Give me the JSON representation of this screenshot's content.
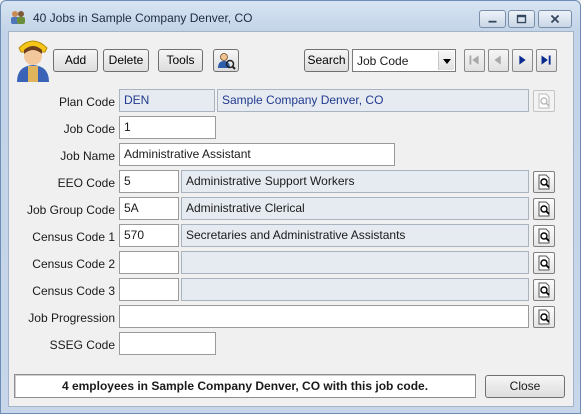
{
  "window": {
    "title": "40 Jobs in Sample Company Denver, CO",
    "controls": {
      "minimize": "minimize-icon",
      "maximize": "maximize-icon",
      "close": "close-icon"
    }
  },
  "toolbar": {
    "add_label": "Add",
    "delete_label": "Delete",
    "tools_label": "Tools",
    "user_icon": "user-search-icon",
    "search_label": "Search",
    "search_field_selected": "Job Code",
    "nav": [
      "first-record-icon",
      "previous-record-icon",
      "next-record-icon",
      "last-record-icon"
    ]
  },
  "form": {
    "plan_code": {
      "label": "Plan Code",
      "code": "DEN",
      "description": "Sample Company Denver, CO"
    },
    "job_code": {
      "label": "Job Code",
      "value": "1"
    },
    "job_name": {
      "label": "Job Name",
      "value": "Administrative Assistant"
    },
    "eeo_code": {
      "label": "EEO Code",
      "code": "5",
      "description": "Administrative Support Workers"
    },
    "job_group_code": {
      "label": "Job Group Code",
      "code": "5A",
      "description": "Administrative Clerical"
    },
    "census_code_1": {
      "label": "Census Code 1",
      "code": "570",
      "description": "Secretaries and Administrative Assistants"
    },
    "census_code_2": {
      "label": "Census Code 2",
      "code": "",
      "description": ""
    },
    "census_code_3": {
      "label": "Census Code 3",
      "code": "",
      "description": ""
    },
    "job_progression": {
      "label": "Job Progression",
      "value": ""
    },
    "sseg_code": {
      "label": "SSEG Code",
      "value": ""
    }
  },
  "footer": {
    "status": "4 employees in Sample Company Denver, CO with this job code.",
    "close_label": "Close"
  },
  "colors": {
    "title_bar": "#c7d6e9",
    "readonly_field": "#e6ebf1",
    "link_text": "#213a8f",
    "nav_arrow": "#0a2a8f"
  }
}
